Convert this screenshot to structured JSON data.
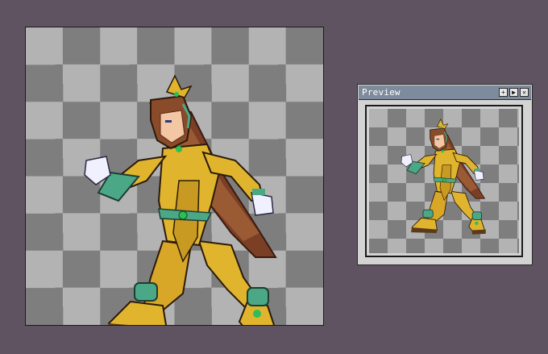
{
  "preview_window": {
    "title": "Preview",
    "buttons": [
      {
        "icon": "move-icon",
        "glyph": "+"
      },
      {
        "icon": "play-icon",
        "glyph": "▶"
      },
      {
        "icon": "close-icon",
        "glyph": "✕"
      }
    ]
  },
  "canvas": {
    "background": "transparency-checkerboard",
    "sprite": "armored-fighter-sprite"
  },
  "colors": {
    "app_background": "#5f5361",
    "checker_dark": "#7e7e7e",
    "checker_light": "#b3b3b3",
    "titlebar": "#7e8b9c",
    "armor_gold": "#e0b52d",
    "armor_green": "#4aa886",
    "hair": "#8a4b2a"
  }
}
